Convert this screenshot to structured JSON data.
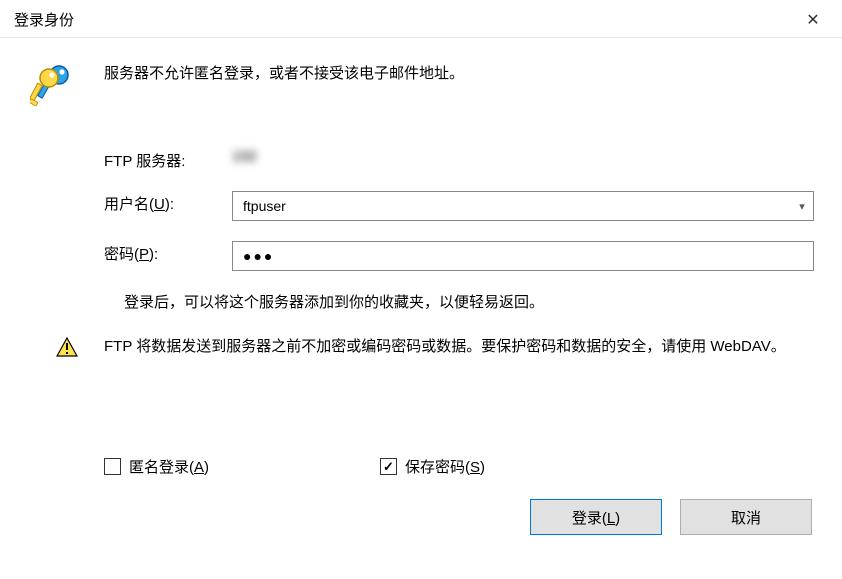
{
  "title": "登录身份",
  "message": "服务器不允许匿名登录，或者不接受该电子邮件地址。",
  "labels": {
    "server": "FTP 服务器:",
    "username_prefix": "用户名(",
    "username_hotkey": "U",
    "username_suffix": "):",
    "password_prefix": "密码(",
    "password_hotkey": "P",
    "password_suffix": "):"
  },
  "values": {
    "server": "192",
    "username": "ftpuser",
    "password_mask": "●●●"
  },
  "info_text": "登录后，可以将这个服务器添加到你的收藏夹，以便轻易返回。",
  "warning_text": "FTP 将数据发送到服务器之前不加密或编码密码或数据。要保护密码和数据的安全，请使用 WebDAV。",
  "checks": {
    "anon_prefix": "匿名登录(",
    "anon_hotkey": "A",
    "anon_suffix": ")",
    "anon_checked": false,
    "save_prefix": "保存密码(",
    "save_hotkey": "S",
    "save_suffix": ")",
    "save_checked": true
  },
  "buttons": {
    "login_prefix": "登录(",
    "login_hotkey": "L",
    "login_suffix": ")",
    "cancel": "取消"
  }
}
